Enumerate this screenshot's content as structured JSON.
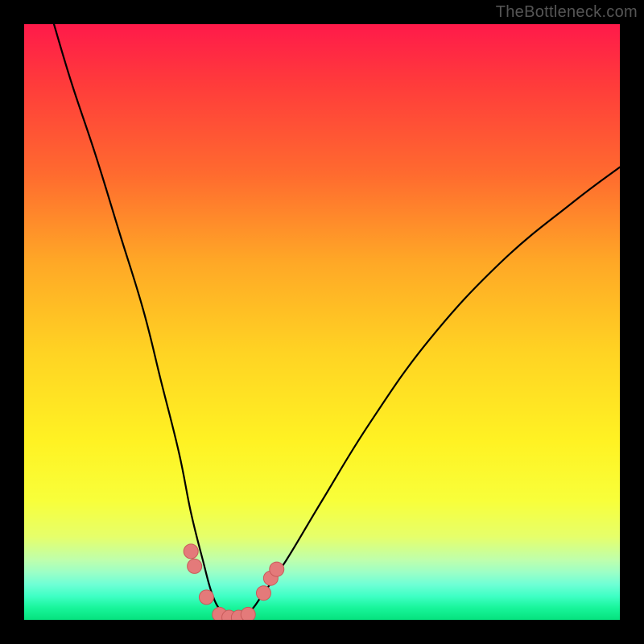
{
  "watermark": "TheBottleneck.com",
  "chart_data": {
    "type": "line",
    "title": "",
    "xlabel": "",
    "ylabel": "",
    "xlim": [
      0,
      100
    ],
    "ylim": [
      0,
      100
    ],
    "series": [
      {
        "name": "bottleneck-curve",
        "x": [
          5,
          8,
          12,
          16,
          20,
          23,
          26,
          28,
          30,
          31.5,
          33,
          34.5,
          36,
          38,
          40,
          44,
          50,
          58,
          68,
          80,
          92,
          100
        ],
        "values": [
          100,
          90,
          78,
          65,
          52,
          40,
          28,
          18,
          10,
          4.5,
          1.5,
          0.3,
          0.3,
          1.5,
          4.2,
          10,
          20,
          33,
          47,
          60,
          70,
          76
        ]
      }
    ],
    "markers": [
      {
        "x": 28.0,
        "y": 11.5
      },
      {
        "x": 28.6,
        "y": 9.0
      },
      {
        "x": 30.6,
        "y": 3.8
      },
      {
        "x": 32.8,
        "y": 0.9
      },
      {
        "x": 34.4,
        "y": 0.4
      },
      {
        "x": 36.0,
        "y": 0.4
      },
      {
        "x": 37.6,
        "y": 0.9
      },
      {
        "x": 40.2,
        "y": 4.5
      },
      {
        "x": 41.4,
        "y": 7.0
      },
      {
        "x": 42.4,
        "y": 8.5
      }
    ],
    "colors": {
      "curve": "#000000",
      "marker_fill": "#e47a7a",
      "marker_stroke": "#c95a5a"
    }
  }
}
